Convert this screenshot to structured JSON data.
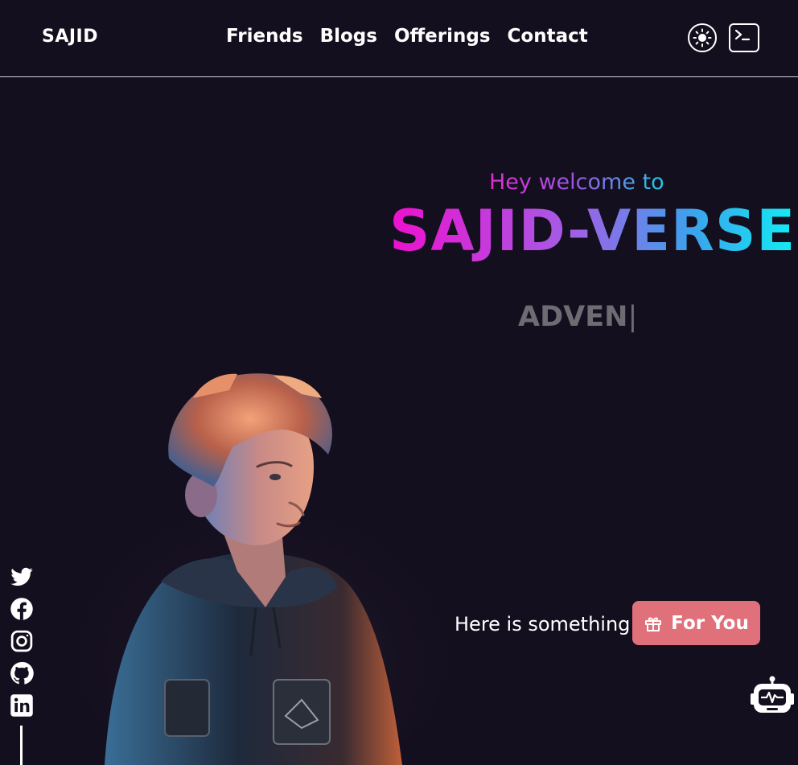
{
  "header": {
    "logo": "SAJID",
    "nav": [
      "Friends",
      "Blogs",
      "Offerings",
      "Contact"
    ],
    "icons": {
      "theme": "sun-icon",
      "terminal": "terminal-icon"
    }
  },
  "hero": {
    "welcome": "Hey welcome to",
    "brand": "SAJID-VERSE",
    "typing": "ADVEN",
    "caret": "|"
  },
  "cta": {
    "text": "Here is something",
    "button_label": "For You",
    "button_icon": "gift-icon",
    "button_color": "#e0707a"
  },
  "socials": [
    "twitter-icon",
    "facebook-icon",
    "instagram-icon",
    "github-icon",
    "linkedin-icon"
  ],
  "bot_icon": "robot-icon",
  "colors": {
    "background": "#140f1e",
    "gradient_start": "#ee10cf",
    "gradient_end": "#12ecf4",
    "typing_text": "#6e6b73"
  }
}
